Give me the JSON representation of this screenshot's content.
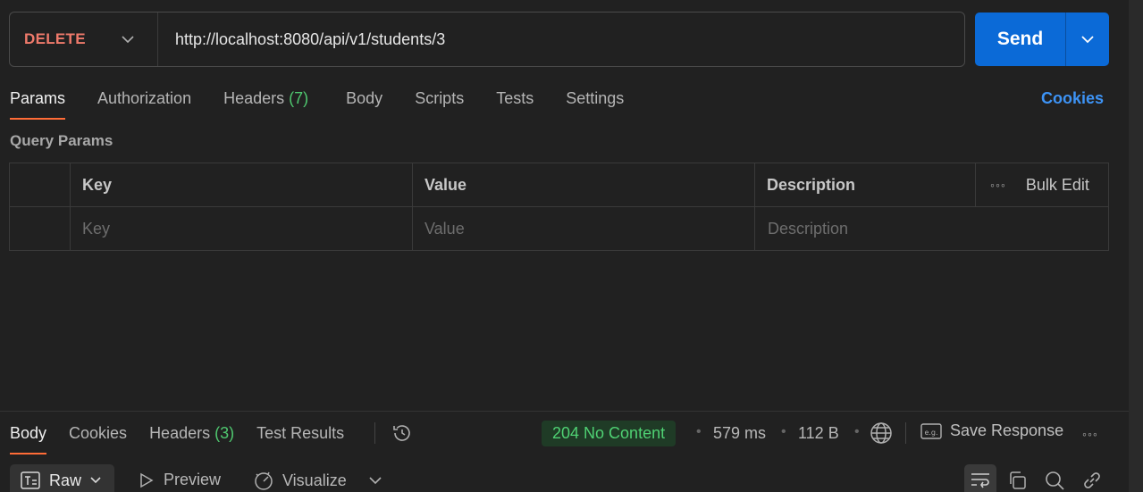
{
  "request": {
    "method": "DELETE",
    "url": "http://localhost:8080/api/v1/students/3",
    "send_label": "Send"
  },
  "request_tabs": {
    "params": "Params",
    "authorization": "Authorization",
    "headers": "Headers",
    "headers_count": "(7)",
    "body": "Body",
    "scripts": "Scripts",
    "tests": "Tests",
    "settings": "Settings",
    "cookies": "Cookies"
  },
  "query_params": {
    "title": "Query Params",
    "columns": {
      "key": "Key",
      "value": "Value",
      "description": "Description",
      "bulk_edit": "Bulk Edit"
    },
    "placeholders": {
      "key": "Key",
      "value": "Value",
      "description": "Description"
    }
  },
  "response_tabs": {
    "body": "Body",
    "cookies": "Cookies",
    "headers": "Headers",
    "headers_count": "(3)",
    "test_results": "Test Results"
  },
  "response_meta": {
    "status": "204 No Content",
    "time": "579 ms",
    "size": "112 B",
    "save_response": "Save Response"
  },
  "response_toolbar": {
    "raw": "Raw",
    "preview": "Preview",
    "visualize": "Visualize"
  },
  "colors": {
    "method": "#ef7a6b",
    "send": "#0b6ad7",
    "accent": "#ff6c37",
    "success": "#4fd173",
    "link": "#3d93f5"
  }
}
